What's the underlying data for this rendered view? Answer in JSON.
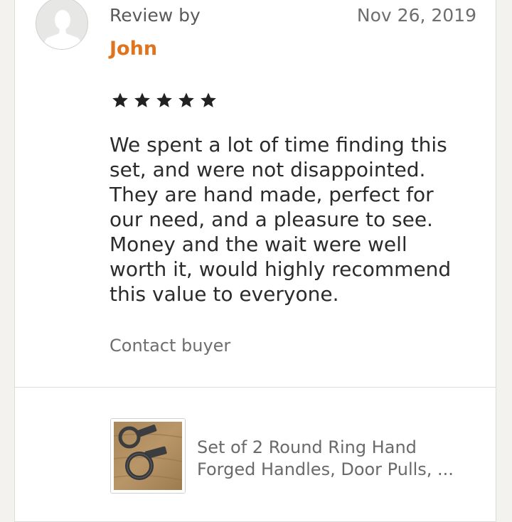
{
  "review": {
    "label": "Review by",
    "reviewer": "John",
    "date": "Nov 26, 2019",
    "rating": 5,
    "rating_max": 5,
    "text_lines": [
      "We spent a lot of time finding this",
      "set, and were not disappointed.",
      "They are hand made, perfect for",
      "our need, and a pleasure to see.",
      "Money and the wait were well",
      "worth it, would highly recommend",
      "this value to everyone."
    ],
    "contact_label": "Contact buyer"
  },
  "product": {
    "title_lines": [
      "Set of 2 Round Ring Hand",
      "Forged Handles, Door Pulls, ..."
    ],
    "thumbnail_icon": "ring-handles-photo"
  },
  "colors": {
    "reviewer_name": "#e0731d",
    "star": "#222222",
    "background": "#f3f2ee",
    "card": "#ffffff"
  }
}
